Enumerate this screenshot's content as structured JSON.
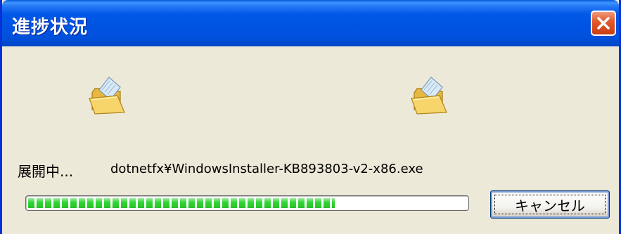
{
  "window": {
    "title": "進捗状況",
    "close_icon": "close-icon"
  },
  "content": {
    "source_icon": "folder-icon",
    "destination_icon": "folder-icon",
    "status_label": "展開中...",
    "file_name": "dotnetfx¥WindowsInstaller-KB893803-v2-x86.exe",
    "progress_percent": 70
  },
  "buttons": {
    "cancel_label": "キャンセル"
  },
  "colors": {
    "titlebar": "#0054E3",
    "window_bg": "#ECE9D8",
    "progress_fill": "#2ED331",
    "close_button": "#E35B2E"
  }
}
